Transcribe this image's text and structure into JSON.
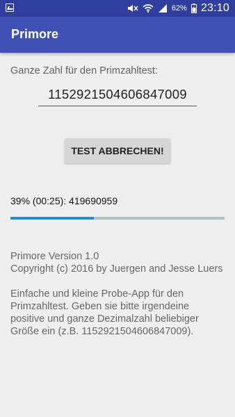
{
  "status_bar": {
    "battery_percent": "62%",
    "time": "23:10",
    "icons": [
      "image-icon",
      "mute-icon",
      "wifi-icon",
      "signal-icon",
      "battery-icon"
    ]
  },
  "app_bar": {
    "title": "Primore"
  },
  "form": {
    "label": "Ganze Zahl für den Primzahltest:",
    "number_value": "1152921504606847009"
  },
  "cancel_button": {
    "label": "TEST ABBRECHEN!"
  },
  "progress": {
    "text": "39% (00:25): 419690959",
    "fraction": 0.39
  },
  "info": {
    "version": "Primore Version 1.0",
    "copyright": "Copyright (c) 2016 by Juergen and Jesse Luers",
    "description": "Einfache und kleine Probe-App für den Primzahltest. Geben sie bitte irgendeine positive und ganze Dezimalzahl beliebiger Größe ein (z.B. 1152921504606847009)."
  },
  "colors": {
    "status_bar": "#303f9f",
    "app_bar": "#3f51b5",
    "progress_fill": "#1e90c9",
    "progress_track": "#b0bec5"
  }
}
